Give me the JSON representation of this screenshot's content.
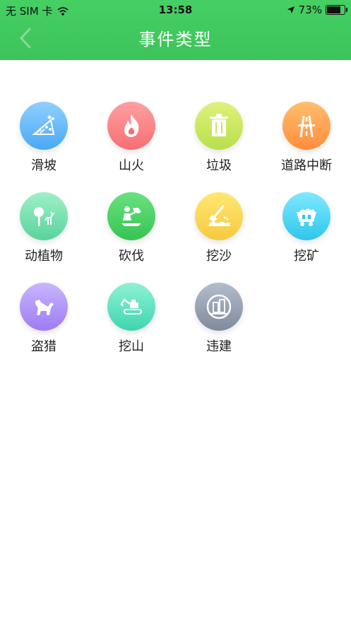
{
  "status_bar": {
    "carrier": "无 SIM 卡",
    "time": "13:58",
    "battery": "73%",
    "battery_level": 0.73
  },
  "nav": {
    "title": "事件类型"
  },
  "items": [
    {
      "label": "滑坡",
      "icon": "landslide-icon",
      "color_top": "#8fd0ff",
      "color_bottom": "#4aa8f5"
    },
    {
      "label": "山火",
      "icon": "fire-icon",
      "color_top": "#ff9fa0",
      "color_bottom": "#f56f73"
    },
    {
      "label": "垃圾",
      "icon": "trash-icon",
      "color_top": "#dff27d",
      "color_bottom": "#b7df4b"
    },
    {
      "label": "道路中断",
      "icon": "road-icon",
      "color_top": "#ffbe6d",
      "color_bottom": "#ff8e3b"
    },
    {
      "label": "动植物",
      "icon": "tree-deer-icon",
      "color_top": "#9ff0c8",
      "color_bottom": "#59d39b"
    },
    {
      "label": "砍伐",
      "icon": "logging-icon",
      "color_top": "#69e27f",
      "color_bottom": "#36c453"
    },
    {
      "label": "挖沙",
      "icon": "sand-shovel-icon",
      "color_top": "#ffe873",
      "color_bottom": "#f6c93f"
    },
    {
      "label": "挖矿",
      "icon": "mine-cart-icon",
      "color_top": "#7fe9ff",
      "color_bottom": "#2fc6ea"
    },
    {
      "label": "盗猎",
      "icon": "poaching-dog-icon",
      "color_top": "#c9b6ff",
      "color_bottom": "#9d7cf3"
    },
    {
      "label": "挖山",
      "icon": "excavator-icon",
      "color_top": "#8ef2d4",
      "color_bottom": "#3fd5ae"
    },
    {
      "label": "违建",
      "icon": "illegal-building-icon",
      "color_top": "#b2bdcc",
      "color_bottom": "#7f8b9c"
    }
  ]
}
